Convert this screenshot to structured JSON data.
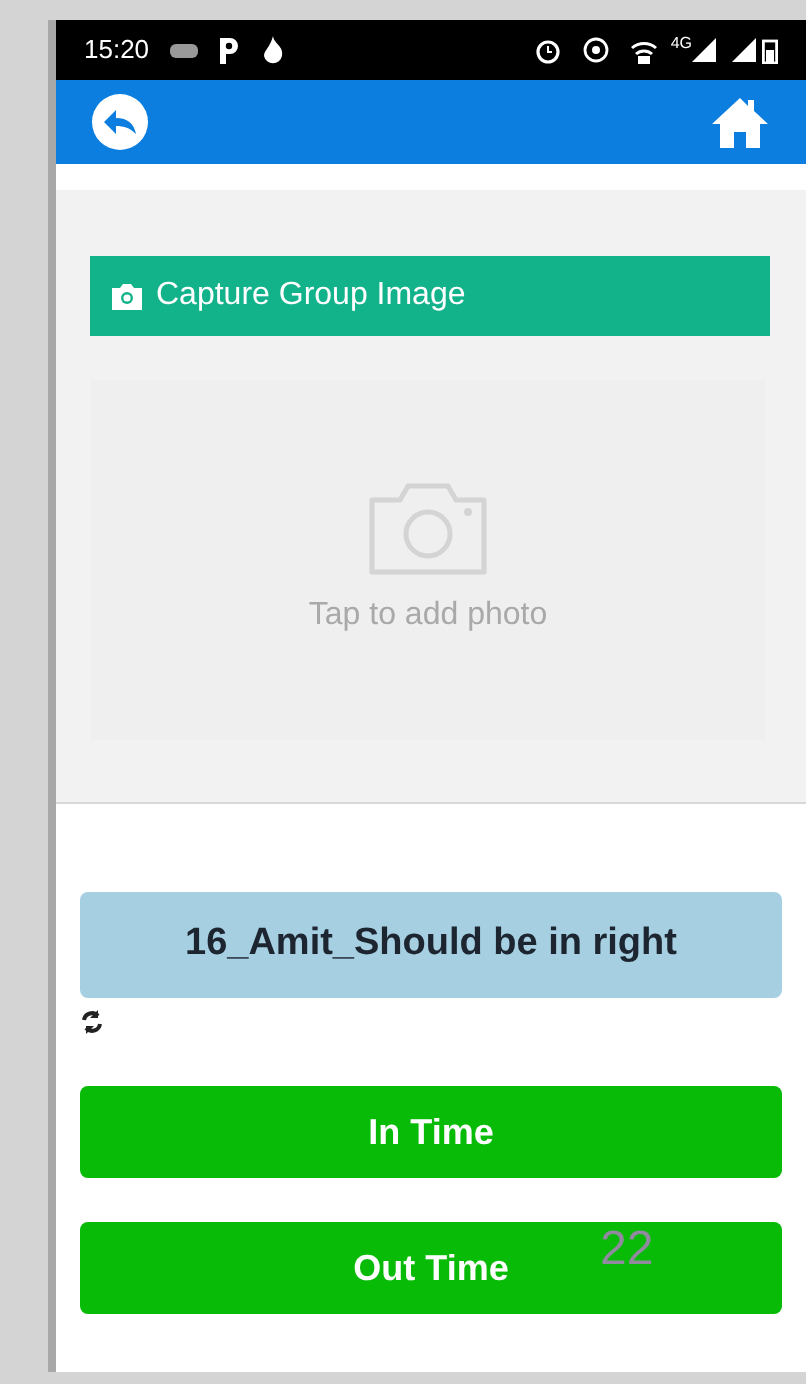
{
  "status_bar": {
    "time": "15:20",
    "network": "4G"
  },
  "capture": {
    "label": "Capture Group Image",
    "placeholder": "Tap to add photo"
  },
  "group_name": "16_Amit_Should be in right",
  "buttons": [
    {
      "label": "In Time"
    },
    {
      "label": "Out Time"
    }
  ],
  "overlay_number": "22"
}
